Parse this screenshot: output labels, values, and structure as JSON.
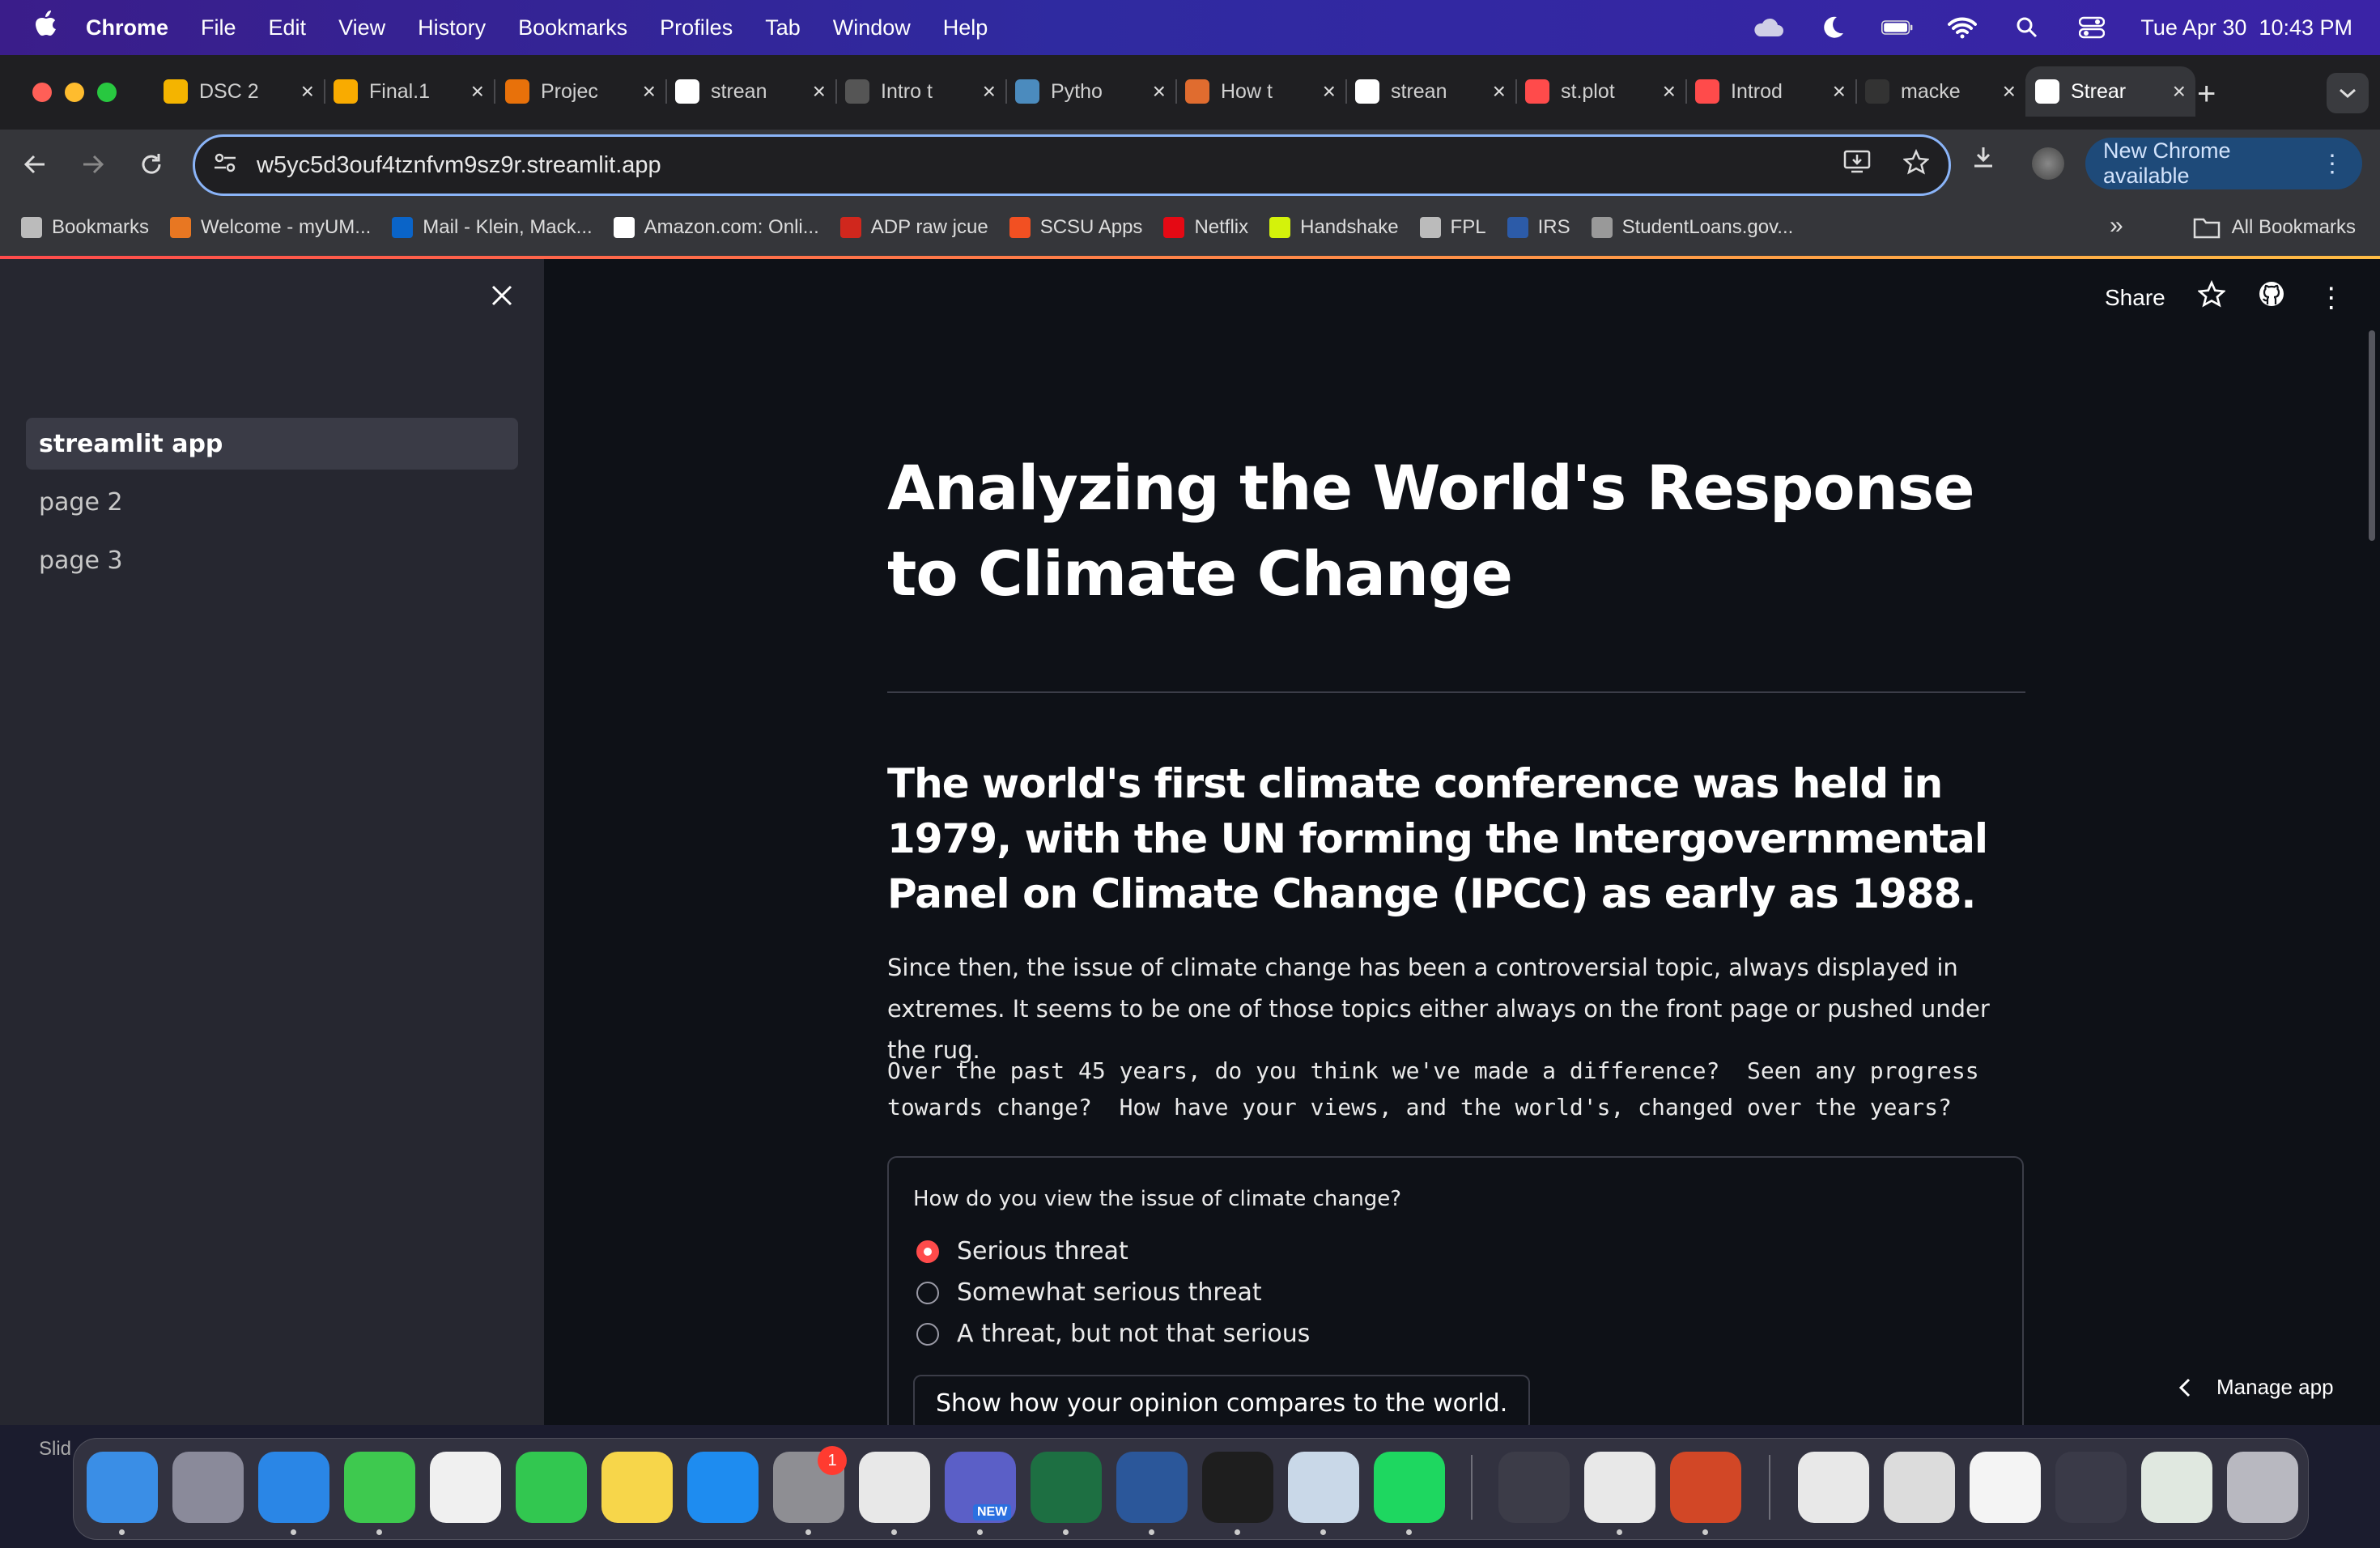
{
  "menubar": {
    "app_name": "Chrome",
    "items": [
      "File",
      "Edit",
      "View",
      "History",
      "Bookmarks",
      "Profiles",
      "Tab",
      "Window",
      "Help"
    ],
    "datetime": "Tue Apr 30  10:43 PM"
  },
  "tabs": [
    {
      "label": "DSC 2",
      "icon": "drive-icon",
      "color": "#f4b400"
    },
    {
      "label": "Final.1",
      "icon": "colab-icon",
      "color": "#f9ab00"
    },
    {
      "label": "Projec",
      "icon": "project-icon",
      "color": "#e8710a"
    },
    {
      "label": "strean",
      "icon": "github-icon",
      "color": "#ffffff"
    },
    {
      "label": "Intro t",
      "icon": "intro-icon",
      "color": "#555555"
    },
    {
      "label": "Pytho",
      "icon": "python-icon",
      "color": "#4b8bbe"
    },
    {
      "label": "How t",
      "icon": "howto-icon",
      "color": "#e06c2f"
    },
    {
      "label": "strean",
      "icon": "streamlit-icon",
      "color": "#ffffff"
    },
    {
      "label": "st.plot",
      "icon": "streamlit-icon",
      "color": "#ff4b4b"
    },
    {
      "label": "Introd",
      "icon": "streamlit-icon",
      "color": "#ff4b4b"
    },
    {
      "label": "macke",
      "icon": "github-icon",
      "color": "#333333"
    },
    {
      "label": "Strear",
      "icon": "streamlit-icon",
      "color": "#ffffff",
      "active": true
    }
  ],
  "address_bar": {
    "url": "w5yc5d3ouf4tznfvm9sz9r.streamlit.app"
  },
  "update_button": "New Chrome available",
  "bookmarks": [
    {
      "label": "Bookmarks",
      "icon": "star-icon",
      "color": "#bbbbbb"
    },
    {
      "label": "Welcome - myUM...",
      "icon": "myum-icon",
      "color": "#e87722"
    },
    {
      "label": "Mail - Klein, Mack...",
      "icon": "outlook-icon",
      "color": "#0a64c8"
    },
    {
      "label": "Amazon.com: Onli...",
      "icon": "amazon-icon",
      "color": "#ffffff"
    },
    {
      "label": "ADP raw jcue",
      "icon": "adp-icon",
      "color": "#d0271d"
    },
    {
      "label": "SCSU Apps",
      "icon": "apps-icon",
      "color": "#f25022"
    },
    {
      "label": "Netflix",
      "icon": "netflix-icon",
      "color": "#e50914"
    },
    {
      "label": "Handshake",
      "icon": "handshake-icon",
      "color": "#d4f20b"
    },
    {
      "label": "FPL",
      "icon": "globe-icon",
      "color": "#bbbbbb"
    },
    {
      "label": "IRS",
      "icon": "irs-icon",
      "color": "#2c5ba8"
    },
    {
      "label": "StudentLoans.gov...",
      "icon": "studentloans-icon",
      "color": "#999999"
    }
  ],
  "all_bookmarks": "All Bookmarks",
  "sidebar": {
    "items": [
      {
        "label": "streamlit app",
        "active": true
      },
      {
        "label": "page 2"
      },
      {
        "label": "page 3"
      }
    ]
  },
  "app_header": {
    "share": "Share"
  },
  "main": {
    "title": "Analyzing the World's Response to Climate Change",
    "subheading": "The world's first climate conference was held in 1979, with the UN forming the Intergovernmental Panel on Climate Change (IPCC) as early as 1988.",
    "paragraph": "Since then, the issue of climate change has been a controversial topic, always displayed in extremes. It seems to be one of those topics either always on the front page or pushed under the rug.",
    "mono_text": "Over the past 45 years, do you think we've made a difference?  Seen any progress towards change?  How have your views, and the world's, changed over the years?",
    "question": "How do you view the issue of climate change?",
    "options": [
      "Serious threat",
      "Somewhat serious threat",
      "A threat, but not that serious"
    ],
    "selected_option": "Serious threat",
    "compare_button": "Show how your opinion compares to the world."
  },
  "manage_app": "Manage app",
  "dock_label": "Slid",
  "dock": {
    "badge_count": "1",
    "new_tag": "NEW",
    "apps": [
      {
        "name": "finder-icon",
        "color": "#3a8ee6"
      },
      {
        "name": "launchpad-icon",
        "color": "#8a8a9a"
      },
      {
        "name": "safari-icon",
        "color": "#2a86e6"
      },
      {
        "name": "messages-icon",
        "color": "#3ec94f"
      },
      {
        "name": "photos-icon",
        "color": "#f0f0f0"
      },
      {
        "name": "facetime-icon",
        "color": "#32c750"
      },
      {
        "name": "notes-icon",
        "color": "#f7d64a"
      },
      {
        "name": "app-store-icon",
        "color": "#1e8cf0"
      },
      {
        "name": "system-settings-icon",
        "color": "#8e8e93"
      },
      {
        "name": "chrome-icon",
        "color": "#e8e8e8"
      },
      {
        "name": "teams-icon",
        "color": "#5b5fc7"
      },
      {
        "name": "excel-icon",
        "color": "#1d6f42"
      },
      {
        "name": "word-icon",
        "color": "#2b579a"
      },
      {
        "name": "terminal-icon",
        "color": "#1e1e1e"
      },
      {
        "name": "python-launcher-icon",
        "color": "#c9d8e8"
      },
      {
        "name": "spotify-icon",
        "color": "#1ed760"
      },
      {
        "name": "quicktime-icon",
        "color": "#3c3c48"
      },
      {
        "name": "textedit-icon",
        "color": "#e8e8e8"
      },
      {
        "name": "powerpoint-icon",
        "color": "#d24726"
      }
    ]
  }
}
